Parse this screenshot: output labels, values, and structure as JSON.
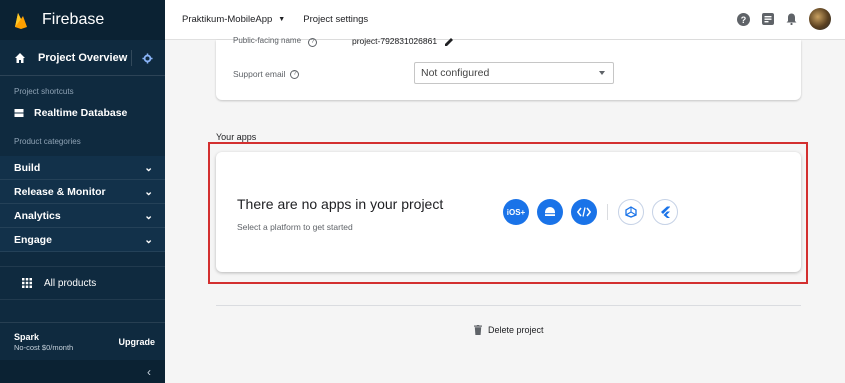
{
  "sidebar": {
    "brand": "Firebase",
    "project_overview": "Project Overview",
    "shortcuts_label": "Project shortcuts",
    "shortcut_item": "Realtime Database",
    "categories_label": "Product categories",
    "categories": [
      "Build",
      "Release & Monitor",
      "Analytics",
      "Engage"
    ],
    "all_products": "All products",
    "plan_name": "Spark",
    "plan_sub": "No-cost $0/month",
    "upgrade": "Upgrade",
    "collapse": "‹"
  },
  "topbar": {
    "project": "Praktikum-MobileApp",
    "settings": "Project settings"
  },
  "settings": {
    "public_name_label": "Public-facing name",
    "public_name_value": "project-792831026861",
    "support_email_label": "Support email",
    "support_email_value": "Not configured"
  },
  "apps": {
    "section_title": "Your apps",
    "empty_title": "There are no apps in your project",
    "empty_sub": "Select a platform to get started",
    "ios_label": "iOS+",
    "platform_icons": [
      "apple-ios-icon",
      "android-icon",
      "web-icon",
      "unity-icon",
      "flutter-icon"
    ]
  },
  "delete_project": "Delete project",
  "colors": {
    "sidebar": "#0f2a3f",
    "accent": "#1a73e8",
    "highlight": "#d32f2f",
    "flame": "#ffa000"
  }
}
